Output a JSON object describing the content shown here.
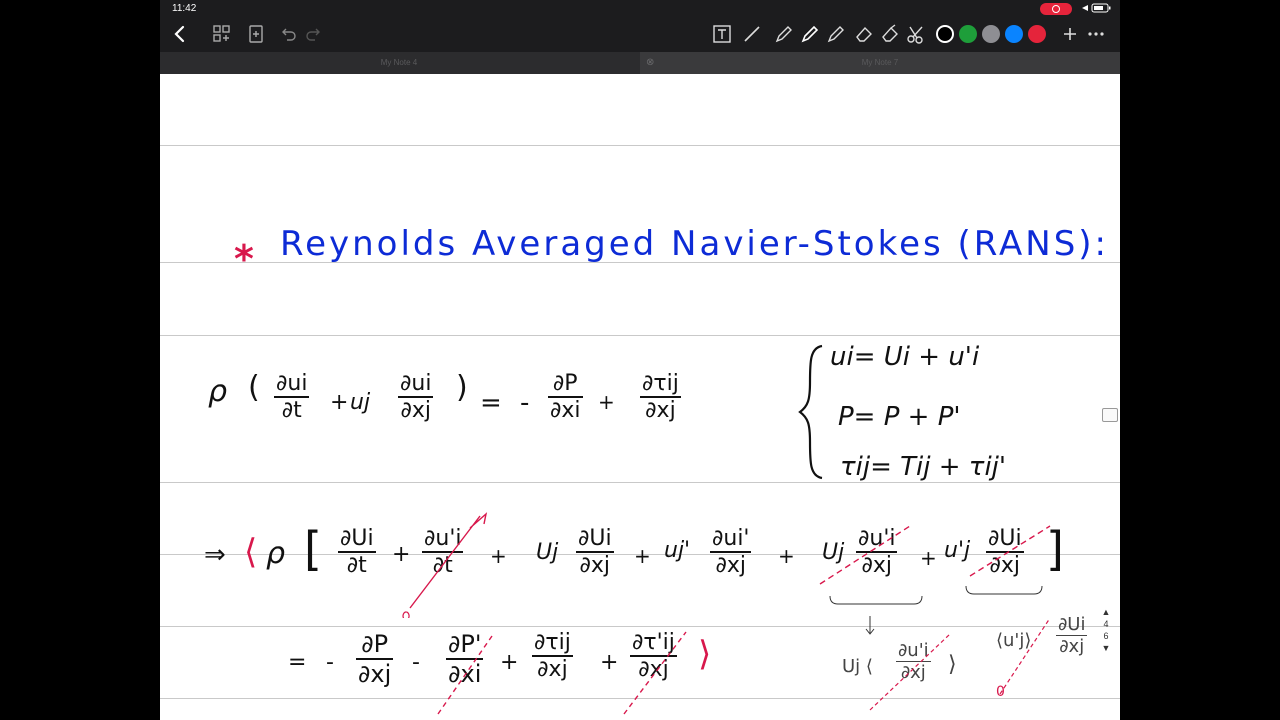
{
  "status": {
    "time": "11:42"
  },
  "tabs": [
    {
      "label": "My Note 4"
    },
    {
      "label": "My Note 7"
    }
  ],
  "colors": {
    "palette": [
      "#000000",
      "#1e9e3a",
      "#8e8e93",
      "#0a84ff",
      "#e5243b"
    ],
    "ink": "#0d2bd6",
    "marker": "#d8184c"
  },
  "icons": [
    "back-icon",
    "thumbnails-icon",
    "add-page-icon",
    "undo-icon",
    "redo-icon",
    "text-tool-icon",
    "lasso-icon",
    "pen-icon",
    "pencil-icon",
    "highlighter-icon",
    "eraser-icon",
    "shape-eraser-icon",
    "scissors-icon",
    "add-icon",
    "more-icon"
  ],
  "note": {
    "title": "Reynolds Averaged Navier-Stokes (RANS):",
    "bullet": "*",
    "eq1": {
      "rho": "ρ",
      "lparen": "(",
      "t1_num": "∂ui",
      "t1_den": "∂t",
      "plus1": "+",
      "uj": "uj",
      "t2_num": "∂ui",
      "t2_den": "∂xj",
      "rparen": ")",
      "eq": "=",
      "minus": "-",
      "t3_num": "∂P",
      "t3_den": "∂xi",
      "plus2": "+",
      "t4_num": "∂τij",
      "t4_den": "∂xj"
    },
    "decomp": {
      "line1": "ui= Ui + u'i",
      "line2": "P=  P + P'",
      "line3": "τij= Tij + τij'"
    },
    "eq2": {
      "arrow": "⇒",
      "bracket_open": "⟨",
      "rho": "ρ",
      "sq_open": "[",
      "a_num": "∂Ui",
      "a_den": "∂t",
      "p1": "+",
      "b_num": "∂u'i",
      "b_den": "∂t",
      "p2": "+",
      "Uj1": "Uj",
      "c_num": "∂Ui",
      "c_den": "∂xj",
      "p3": "+",
      "uj1": "uj'",
      "d_num": "∂ui'",
      "d_den": "∂xj",
      "p4": "+",
      "Uj2": "Uj",
      "e_num": "∂u'i",
      "e_den": "∂xj",
      "p5": "+",
      "uj2": "u'j",
      "f_num": "∂Ui",
      "f_den": "∂xj",
      "sq_close": "]"
    },
    "eq3": {
      "eq": "=",
      "minus1": "-",
      "a_num": "∂P",
      "a_den": "∂xj",
      "minus2": "-",
      "b_num": "∂P'",
      "b_den": "∂xi",
      "plus1": "+",
      "c_num": "∂τij",
      "c_den": "∂xj",
      "plus2": "+",
      "d_num": "∂τ'ij",
      "d_den": "∂xj",
      "bracket_close": "⟩"
    },
    "side_notes": {
      "n1_pre": "Uj ⟨",
      "n1_num": "∂u'i",
      "n1_den": "∂xj",
      "n1_post": "⟩",
      "n2_pre": "⟨u'j⟩",
      "n2_num": "∂Ui",
      "n2_den": "∂xj",
      "zero": "0"
    },
    "pager": {
      "current": "4",
      "total": "6"
    }
  }
}
